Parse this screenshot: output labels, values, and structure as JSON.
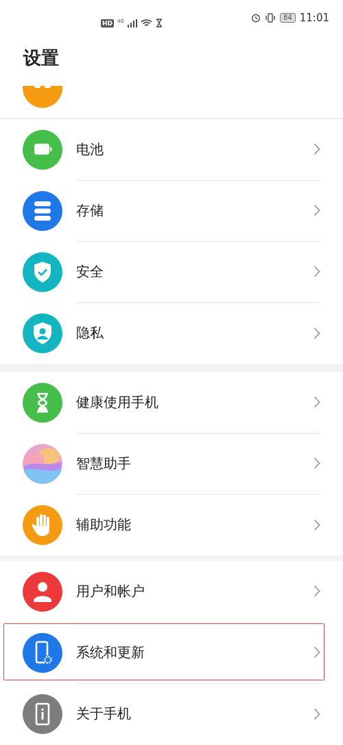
{
  "status_bar": {
    "network_badge": "HD",
    "network_type": "4G",
    "battery": "84",
    "time": "11:01"
  },
  "title": "设置",
  "clipped_item": {
    "color": "#f59b12"
  },
  "groups": [
    {
      "items": [
        {
          "label": "电池",
          "color": "#46bf4a",
          "highlighted": false
        },
        {
          "label": "存储",
          "color": "#1f78e8",
          "highlighted": false
        },
        {
          "label": "安全",
          "color": "#13b5c0",
          "highlighted": false
        },
        {
          "label": "隐私",
          "color": "#13b5c0",
          "highlighted": false
        }
      ]
    },
    {
      "items": [
        {
          "label": "健康使用手机",
          "color": "#46bf4a",
          "highlighted": false
        },
        {
          "label": "智慧助手",
          "color": "#e9a6c8",
          "highlighted": false
        },
        {
          "label": "辅助功能",
          "color": "#f59b12",
          "highlighted": false
        }
      ]
    },
    {
      "items": [
        {
          "label": "用户和帐户",
          "color": "#ec3a3a",
          "highlighted": false
        },
        {
          "label": "系统和更新",
          "color": "#1f78e8",
          "highlighted": true
        },
        {
          "label": "关于手机",
          "color": "#7d7d7d",
          "highlighted": false
        }
      ]
    }
  ]
}
